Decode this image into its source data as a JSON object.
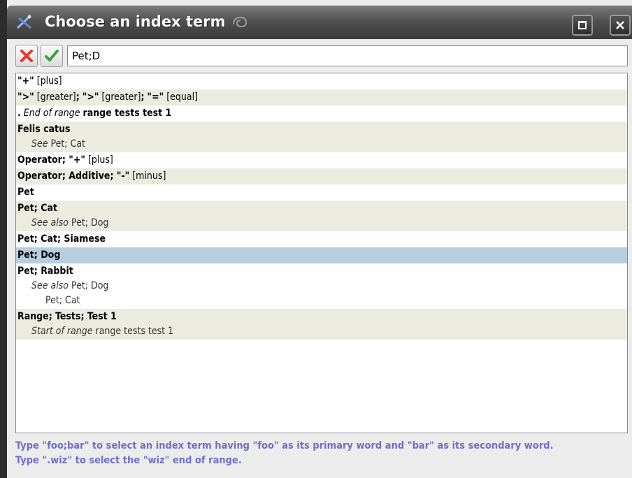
{
  "window": {
    "title": "Choose an index term"
  },
  "toolbar": {
    "search_value": "Pet;D"
  },
  "entries": [
    {
      "id": "e0",
      "alt": false,
      "selected": false
    },
    {
      "id": "e1",
      "alt": true,
      "selected": false
    },
    {
      "id": "e2",
      "alt": false,
      "selected": false
    },
    {
      "id": "e3",
      "alt": true,
      "selected": false
    },
    {
      "id": "e4",
      "alt": false,
      "selected": false
    },
    {
      "id": "e5",
      "alt": true,
      "selected": false
    },
    {
      "id": "e6",
      "alt": false,
      "selected": false
    },
    {
      "id": "e7",
      "alt": true,
      "selected": false
    },
    {
      "id": "e8",
      "alt": false,
      "selected": false
    },
    {
      "id": "e9",
      "alt": false,
      "selected": true
    },
    {
      "id": "e10",
      "alt": false,
      "selected": false
    },
    {
      "id": "e11",
      "alt": true,
      "selected": false
    }
  ],
  "text": {
    "e0_term": "\"+\"",
    "e0_sort": "[plus]",
    "e1_t1": "\">\"",
    "e1_s1": "[greater]",
    "e1_sep1": ";",
    "e1_t2": "\">\"",
    "e1_s2": "[greater]",
    "e1_sep2": ";",
    "e1_t3": "\"=\"",
    "e1_s3": "[equal]",
    "e2_dot": ".",
    "e2_range": "End of range",
    "e2_term": "range tests test 1",
    "e3_term": "Felis catus",
    "e3_see": "See",
    "e3_target": "Pet; Cat",
    "e4_term": "Operator; \"+\"",
    "e4_sort": "[plus]",
    "e5_term": "Operator; Additive; \"-\"",
    "e5_sort": "[minus]",
    "e6_term": "Pet",
    "e7_term": "Pet; Cat",
    "e7_see": "See also",
    "e7_target": "Pet; Dog",
    "e8_term": "Pet; Cat; Siamese",
    "e9_term": "Pet; Dog",
    "e10_term": "Pet; Rabbit",
    "e10_see": "See also",
    "e10_target1": "Pet; Dog",
    "e10_target2": "Pet; Cat",
    "e11_term": "Range; Tests; Test 1",
    "e11_range": "Start of range",
    "e11_target": "range tests test 1"
  },
  "help": {
    "line1": "Type \"foo;bar\" to select an index term having \"foo\" as its primary word and \"bar\" as its secondary word.",
    "line2": "Type \".wiz\" to select the \"wiz\" end of range."
  },
  "colors": {
    "alt_row": "#ebebdf",
    "selected_row": "#b7cde0",
    "help_text": "#6f6fc8",
    "cancel_icon": "#e03a2c",
    "ok_icon": "#3aa33a"
  },
  "icons": {
    "window": "xmlmind-app-icon",
    "swirl": "swirl-decoration-icon",
    "maximize": "maximize-icon",
    "close": "close-icon",
    "cancel": "red-x-icon",
    "ok": "green-check-icon"
  }
}
